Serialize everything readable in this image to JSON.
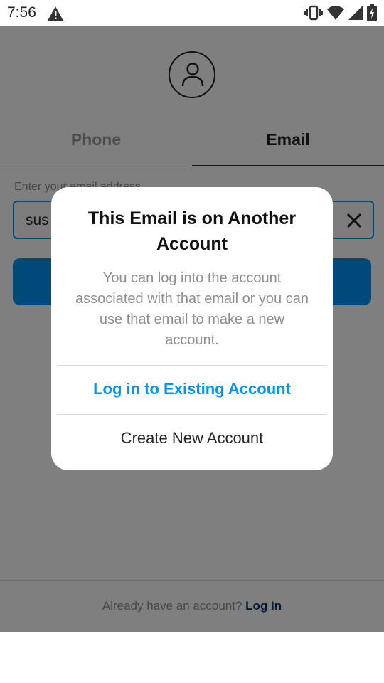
{
  "status_bar": {
    "time": "7:56",
    "icons": [
      "warning-icon",
      "vibrate-icon",
      "wifi-icon",
      "cell-signal-icon",
      "battery-charging-icon"
    ]
  },
  "tabs": [
    {
      "label": "Phone",
      "active": false
    },
    {
      "label": "Email",
      "active": true
    }
  ],
  "email_form": {
    "label": "Enter your email address",
    "value": "sus",
    "clear_icon": "close-icon",
    "accent_color": "#0095f6"
  },
  "footer": {
    "prompt": "Already have an account?",
    "link": "Log In"
  },
  "dialog": {
    "title": "This Email is on Another Account",
    "message": "You can log into the account associated with that email or you can use that email to make a new account.",
    "primary_action": "Log in to Existing Account",
    "secondary_action": "Create New Account"
  }
}
